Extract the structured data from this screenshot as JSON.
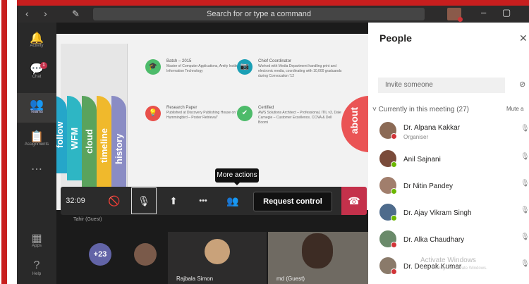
{
  "titlebar": {
    "search_placeholder": "Search for or type a command",
    "back": "‹",
    "forward": "›",
    "compose": "✎",
    "minimize": "–",
    "maximize": "▢",
    "close": "✕"
  },
  "rail": [
    {
      "icon": "🔔",
      "label": "Activity"
    },
    {
      "icon": "💬",
      "label": "Chat",
      "badge": "1"
    },
    {
      "icon": "👥",
      "label": "Teams"
    },
    {
      "icon": "📋",
      "label": "Assignments"
    },
    {
      "icon": "⋯",
      "label": ""
    },
    {
      "icon": "▦",
      "label": "Apps"
    },
    {
      "icon": "?",
      "label": "Help"
    }
  ],
  "slide": {
    "tabs": [
      "history",
      "timeline",
      "cloud",
      "WFM",
      "follow"
    ],
    "tab_colors": [
      "#8a8cc4",
      "#f0b92c",
      "#5aa35d",
      "#2eb6c4",
      "#25a6c9"
    ],
    "cards": [
      {
        "title": "Batch – 2015",
        "text": "Master of Computer Applications, Amity Institute of Information Technology",
        "color": "#4dbb6a",
        "icon": "🎓"
      },
      {
        "title": "Chief Coordinator",
        "text": "Worked with Media Department handling print and electronic media, coordinating with 10,000 graduands during Convocation '12",
        "color": "#1a9fb5",
        "icon": "📷"
      },
      {
        "title": "Research Paper",
        "text": "Published at Discovery Publishing House on \"Google Hummingbird – Poster Retrieval\"",
        "color": "#e8504a",
        "icon": "💡"
      },
      {
        "title": "Certified",
        "text": "AWS Solutions Architect – Professional, ITIL v3, Dale Carnegie – Customer Excellence, CCNA & Dell Boomi",
        "color": "#4dbb6a",
        "icon": "✔"
      }
    ],
    "about": "about"
  },
  "controls": {
    "timer": "32:09",
    "tooltip": "More actions",
    "request_control": "Request control",
    "camera_off": "🚫",
    "mic_off": "🎙",
    "share": "⬆",
    "more": "•••",
    "participants": "👥",
    "hangup": "☎"
  },
  "speaker_tag": "Tahir (Guest)",
  "tiles": [
    {
      "name": "+23"
    },
    {
      "name": ""
    },
    {
      "name": "Rajbala Simon"
    },
    {
      "name": "md (Guest)"
    }
  ],
  "people": {
    "title": "People",
    "invite_placeholder": "Invite someone",
    "section": "Currently in this meeting (27)",
    "mute_all": "Mute a",
    "list": [
      {
        "name": "Dr. Alpana Kakkar",
        "role": "Organiser",
        "color": "#8b6a55",
        "status": "#d13438"
      },
      {
        "name": "Anil Sajnani",
        "role": "",
        "color": "#7a4b3a",
        "status": "#6bb700"
      },
      {
        "name": "Dr Nitin Pandey",
        "role": "",
        "color": "#a17e6c",
        "status": "#6bb700"
      },
      {
        "name": "Dr. Ajay Vikram Singh",
        "role": "",
        "color": "#4e6b8c",
        "status": "#6bb700"
      },
      {
        "name": "Dr. Alka Chaudhary",
        "role": "",
        "color": "#6a8a6a",
        "status": "#d13438"
      },
      {
        "name": "Dr. Deepak Kumar",
        "role": "",
        "color": "#8a7a6a",
        "status": "#d13438"
      }
    ]
  },
  "watermark": {
    "line1": "Activate Windows",
    "line2": "Go to Settings to activate Windows."
  }
}
